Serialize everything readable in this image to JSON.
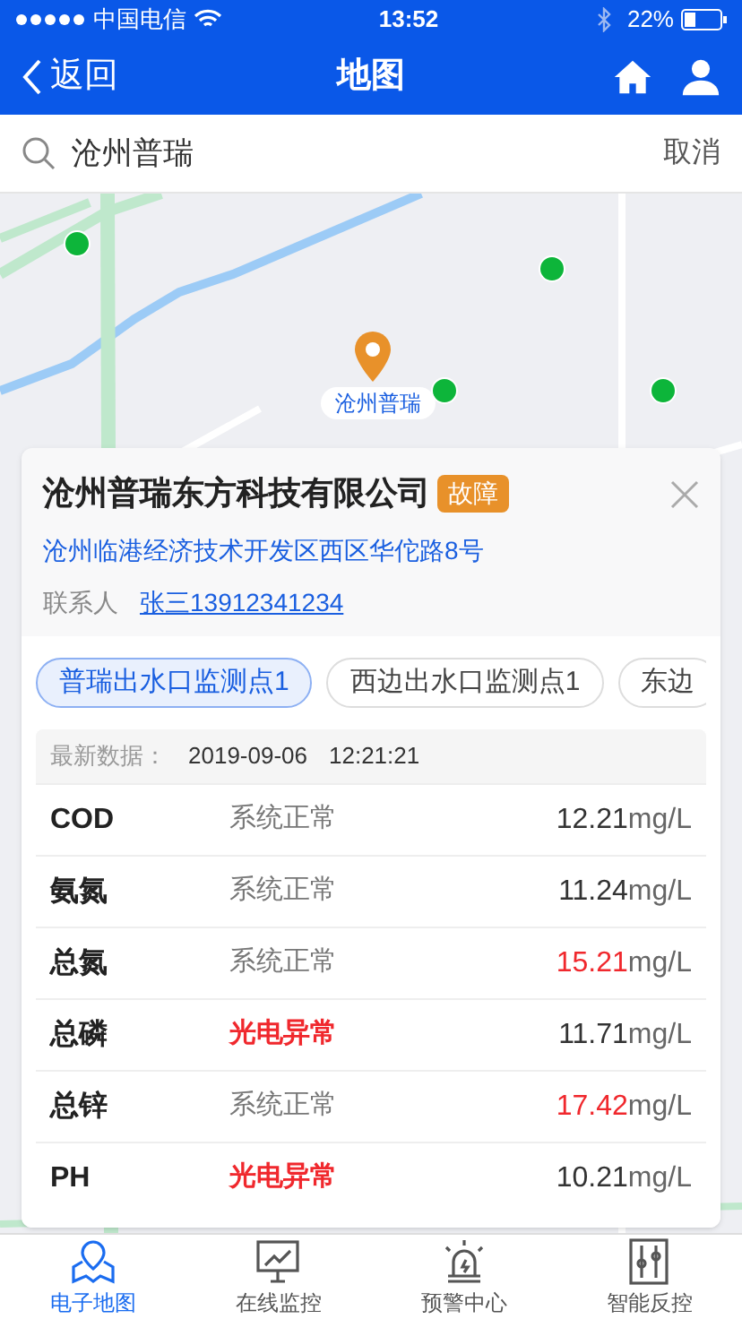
{
  "status_bar": {
    "carrier": "中国电信",
    "time": "13:52",
    "battery": "22%"
  },
  "nav": {
    "back": "返回",
    "title": "地图"
  },
  "search": {
    "value": "沧州普瑞",
    "cancel": "取消"
  },
  "map": {
    "kind": "picture",
    "pin_label": "沧州普瑞"
  },
  "card": {
    "title": "沧州普瑞东方科技有限公司",
    "badge": "故障",
    "address": "沧州临港经济技术开发区西区华佗路8号",
    "contact_label": "联系人",
    "contact": "张三13912341234",
    "points": [
      {
        "label": "普瑞出水口监测点1",
        "selected": true
      },
      {
        "label": "西边出水口监测点1",
        "selected": false
      },
      {
        "label": "东边",
        "selected": false
      }
    ],
    "latest_label": "最新数据：",
    "latest_date": "2019-09-06",
    "latest_time": "12:21:21",
    "rows": [
      {
        "name": "COD",
        "status": "系统正常",
        "status_alarm": false,
        "value": "12.21",
        "value_alarm": false,
        "unit": "mg/L"
      },
      {
        "name": "氨氮",
        "status": "系统正常",
        "status_alarm": false,
        "value": "11.24",
        "value_alarm": false,
        "unit": "mg/L"
      },
      {
        "name": "总氮",
        "status": "系统正常",
        "status_alarm": false,
        "value": "15.21",
        "value_alarm": true,
        "unit": "mg/L"
      },
      {
        "name": "总磷",
        "status": "光电异常",
        "status_alarm": true,
        "value": "11.71",
        "value_alarm": false,
        "unit": "mg/L"
      },
      {
        "name": "总锌",
        "status": "系统正常",
        "status_alarm": false,
        "value": "17.42",
        "value_alarm": true,
        "unit": "mg/L"
      },
      {
        "name": "PH",
        "status": "光电异常",
        "status_alarm": true,
        "value": "10.21",
        "value_alarm": false,
        "unit": "mg/L"
      }
    ]
  },
  "tab_bar": [
    {
      "label": "电子地图",
      "kind": "map",
      "selected": true
    },
    {
      "label": "在线监控",
      "kind": "monitor",
      "selected": false
    },
    {
      "label": "预警中心",
      "kind": "alarm",
      "selected": false
    },
    {
      "label": "智能反控",
      "kind": "sliders",
      "selected": false
    }
  ]
}
